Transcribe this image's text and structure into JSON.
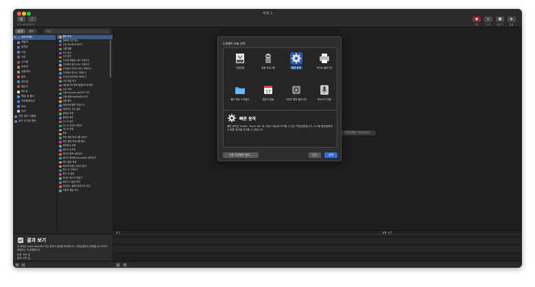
{
  "window": {
    "title": "무제 3"
  },
  "toolbar": {
    "left_buttons": [
      "라이브러리",
      "미디어"
    ],
    "right_buttons": [
      "기록",
      "단계",
      "멈추기",
      "실행"
    ]
  },
  "library": {
    "tabs": [
      "동작",
      "변수"
    ],
    "search_placeholder": "이름",
    "categories": [
      {
        "label": "라이브러리",
        "level": "top",
        "selected": true
      },
      {
        "label": "개발자",
        "level": "child"
      },
      {
        "label": "동영상",
        "level": "child"
      },
      {
        "label": "사진",
        "level": "child"
      },
      {
        "label": "사파",
        "level": "child"
      },
      {
        "label": "시스템",
        "level": "child"
      },
      {
        "label": "연락처",
        "level": "child"
      },
      {
        "label": "유틸리티",
        "level": "child"
      },
      {
        "label": "음악",
        "level": "child"
      },
      {
        "label": "인터넷",
        "level": "child"
      },
      {
        "label": "캘린더",
        "level": "child"
      },
      {
        "label": "텍스트",
        "level": "child"
      },
      {
        "label": "파일 및 폴더",
        "level": "child"
      },
      {
        "label": "프레젠테이션",
        "level": "child"
      },
      {
        "label": "Mail",
        "level": "child"
      },
      {
        "label": "PDF",
        "level": "child"
      },
      {
        "label": "가장 많이 사용됨",
        "level": "top"
      },
      {
        "label": "최근 추가된 항목",
        "level": "top"
      }
    ],
    "actions": [
      "결과 보기",
      "경로명 사진 휴시",
      "구성 요소에 추가하기",
      "그룹 병합",
      "기사 표시",
      "기사 얻기",
      "기사에 포함된 URL 가져오기",
      "기사에서 링크 URL 가져오기",
      "기사에서 이미지 URL 가져오기",
      "기사에서 텍스트 가져오기",
      "기사의 마지막에 가져오기",
      "나의 작업 보기",
      "네트워크의 항목 클립보드에 복사",
      "노트 요청",
      "다중 Keynote 슬라이드 보기",
      "다중 응용 Netflix에서 보기",
      "대체 필터",
      "데이터에 항목 가져오기",
      "데이터의 사진 설정",
      "동영상 요청",
      "동영상 확인",
      "디스크 굽기",
      "디스크 이미지 마운트",
      "디스크 추출",
      "루프",
      "모든 응용 프로그램 가져기",
      "모든 응용 프로그램 종료",
      "목록에서 선택",
      "미디어 인코딩",
      "미디어 항목 내보내기",
      "미디어 항목을 Keynote로 내보내기",
      "미디 알림 재생",
      "미리보기에서 이미지 열기",
      "받는 신 가져오기",
      "받는 신 설정",
      "보내는 메시지 만들기",
      "비디오 스냅샷 찍기",
      "비어있는 클레이어리스트 제거",
      "사용자 제일 처기"
    ],
    "selected_action_index": 0
  },
  "description": {
    "title": "결과 보기",
    "text": "이 동작은 Automator에서 이전 동작의 결과를 보여줍니다. 작업흐름에서 문제를 디스크하고 해결하는 데 유용합니다.",
    "input_label": "입력: 모든 값",
    "output_label": "결과: 모든 값"
  },
  "workflow": {
    "hint": "작업흐름을 구축하십시오."
  },
  "log": {
    "col_log": "로그",
    "col_duration": "실행 시간"
  },
  "sheet": {
    "title": "도큐멘트 유형 선택:",
    "templates": [
      {
        "label": "작업흐름",
        "icon": "workflow-icon"
      },
      {
        "label": "응용 프로그램",
        "icon": "application-robot-icon"
      },
      {
        "label": "빠른 동작",
        "icon": "gear-icon",
        "selected": true
      },
      {
        "label": "프린트 플러그인",
        "icon": "printer-icon"
      },
      {
        "label": "폴더 재로 스크립트",
        "icon": "folder-icon"
      },
      {
        "label": "캘린더 알림",
        "icon": "calendar-icon"
      },
      {
        "label": "이미지 캡처 플러그인",
        "icon": "image-capture-icon"
      },
      {
        "label": "받아쓰기 명령",
        "icon": "microphone-icon"
      }
    ],
    "calendar_day": "17",
    "info_title": "빠른 동작",
    "info_text": "빠른 동작은 Finder, Touch Bar 및 서비스 메뉴에 추가할 수 있는 작업흐름입니다. 시스템 환경설정에서 빠른 동작을 관리할 수 있습니다.",
    "btn_existing": "기존 도큐멘트 열기...",
    "btn_close": "닫기",
    "btn_choose": "선택"
  },
  "colors": {
    "selection": "#3d5a8a",
    "primary_button": "#2f6fe0",
    "sheet_selection": "#2b5aa3"
  }
}
